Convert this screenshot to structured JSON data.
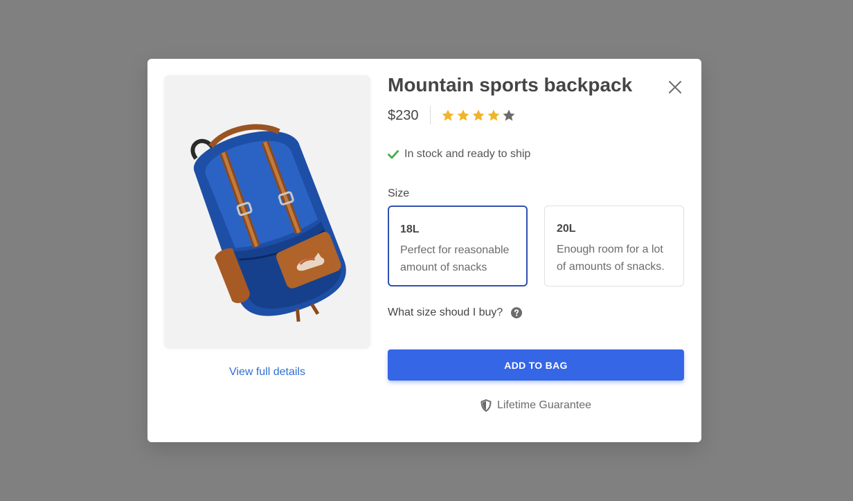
{
  "product": {
    "title": "Mountain sports backpack",
    "price": "$230",
    "rating": 4,
    "rating_max": 5,
    "stock_text": "In stock and ready to ship",
    "view_details_label": "View full details",
    "image_alt": "Blue backpack with brown leather straps and fox patch"
  },
  "size": {
    "label": "Size",
    "options": [
      {
        "name": "18L",
        "description": "Perfect for reasonable amount of snacks",
        "selected": true
      },
      {
        "name": "20L",
        "description": "Enough room for a lot of amounts of snacks.",
        "selected": false
      }
    ],
    "help_text": "What size shoud I buy?"
  },
  "actions": {
    "add_to_bag_label": "ADD TO BAG",
    "guarantee_text": "Lifetime Guarantee"
  },
  "icons": {
    "close": "close-icon",
    "star": "star-icon",
    "check": "check-icon",
    "help": "question-circle-icon",
    "shield": "shield-icon"
  },
  "colors": {
    "backdrop": "#808080",
    "accent": "#3566e6",
    "link": "#2f6fd1",
    "star_filled": "#f0b429",
    "star_empty": "#6b6b6b",
    "stock_check": "#4caf50",
    "selected_border": "#2f4fb0"
  }
}
